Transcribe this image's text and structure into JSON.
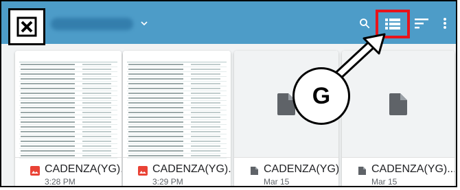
{
  "appbar": {
    "title": "",
    "bg_color": "#4d9cc8",
    "icons": [
      "x-box-icon",
      "chevron-down-icon",
      "search-icon",
      "list-view-icon",
      "sort-icon",
      "more-vert-icon"
    ]
  },
  "highlight_color": "#e8141b",
  "callout": {
    "letter": "G"
  },
  "files": [
    {
      "name": "CADENZA(YG)...",
      "date": "3:28 PM",
      "type": "image"
    },
    {
      "name": "CADENZA(YG)...",
      "date": "3:29 PM",
      "type": "image"
    },
    {
      "name": "CADENZA(YG)...",
      "date": "Mar 15",
      "type": "doc"
    },
    {
      "name": "CADENZA(YG)...",
      "date": "Mar 15",
      "type": "doc"
    }
  ]
}
